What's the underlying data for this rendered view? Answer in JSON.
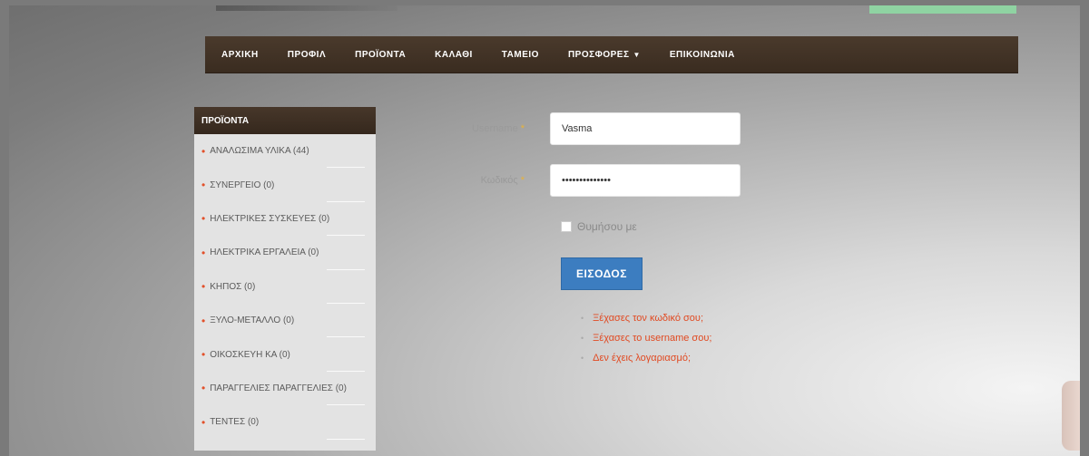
{
  "nav": {
    "items": [
      "ΑΡΧΙΚΗ",
      "ΠΡΟΦΙΛ",
      "ΠΡΟΪΟΝΤΑ",
      "ΚΑΛΑΘΙ",
      "ΤΑΜΕΙΟ",
      "ΠΡΟΣΦΟΡΕΣ",
      "ΕΠΙΚΟΙΝΩΝΙΑ"
    ]
  },
  "sidebar": {
    "title": "ΠΡΟΪΟΝΤΑ",
    "categories": [
      "ΑΝΑΛΩΣΙΜΑ ΥΛΙΚΑ (44)",
      "ΣΥΝΕΡΓΕΙΟ (0)",
      "ΗΛΕΚΤΡΙΚΕΣ ΣΥΣΚΕΥΕΣ (0)",
      "ΗΛΕΚΤΡΙΚΑ ΕΡΓΑΛΕΙΑ (0)",
      "ΚΗΠΟΣ (0)",
      "ΞΥΛΟ-ΜΕΤΑΛΛΟ (0)",
      "ΟΙΚΟΣΚΕΥΗ ΚΑ (0)",
      "ΠΑΡΑΓΓΕΛΙΕΣ ΠΑΡΑΓΓΕΛΙΕΣ (0)",
      "ΤΕΝΤΕΣ (0)"
    ]
  },
  "form": {
    "username_label": "Username",
    "username_value": "Vasma",
    "password_label": "Κωδικός",
    "password_value": "••••••••••••••",
    "remember_label": "Θυμήσου με",
    "login_button": "ΕΙΣΟΔΟΣ",
    "links": [
      "Ξέχασες τον κωδικό σου;",
      "Ξέχασες το username σου;",
      "Δεν έχεις λογαριασμό;"
    ]
  },
  "colors": {
    "nav_bg": "#3f3024",
    "button": "#3c7dc0",
    "link": "#e14a22",
    "bullet": "#e2502a"
  }
}
